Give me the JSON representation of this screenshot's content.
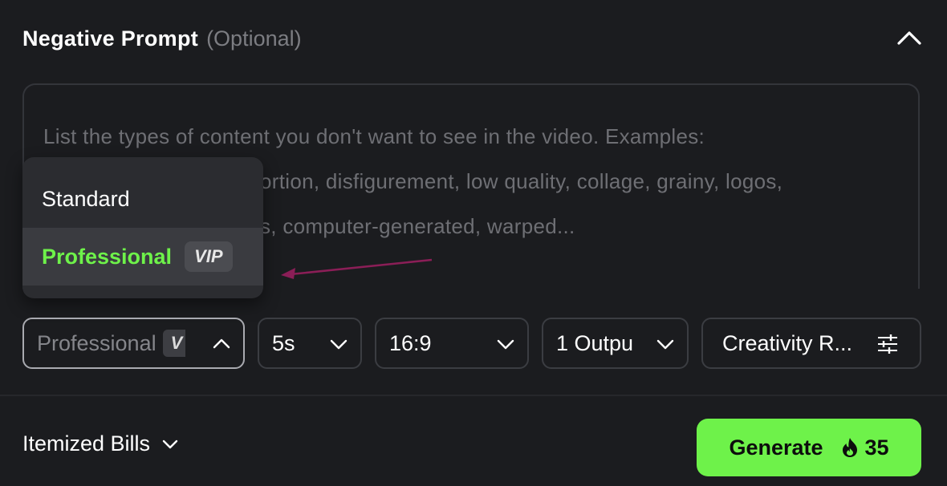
{
  "header": {
    "title": "Negative Prompt",
    "optional": "(Optional)"
  },
  "textarea": {
    "placeholder": "List the types of content you don't want to see in the video. Examples: animation, blur, distortion, disfigurement, low quality, collage, grainy, logos, abstract, illustrations, computer-generated, warped...",
    "line1": "List the types of content you don't want to see in the video. Examples:",
    "line2": "ortion, disfigurement, low quality, collage, grainy, logos,",
    "line3": "s, computer-generated, warped..."
  },
  "quality_menu": {
    "options": [
      {
        "label": "Standard",
        "selected": false
      },
      {
        "label": "Professional",
        "badge": "VIP",
        "selected": true
      }
    ]
  },
  "controls": {
    "quality": {
      "value": "Professional",
      "badge": "V"
    },
    "duration": {
      "value": "5s"
    },
    "aspect_ratio": {
      "value": "16:9"
    },
    "outputs": {
      "value": "1 Outpu"
    },
    "creativity": {
      "value": "Creativity R..."
    }
  },
  "footer": {
    "bills_label": "Itemized Bills",
    "generate_label": "Generate",
    "credits": "35"
  },
  "colors": {
    "accent": "#6ef24a",
    "background": "#1b1c1f",
    "annotation_arrow": "#8b1e57"
  },
  "icons": [
    "chevron-up-icon",
    "chevron-down-icon",
    "sliders-icon",
    "flame-icon",
    "annotation-arrow"
  ]
}
